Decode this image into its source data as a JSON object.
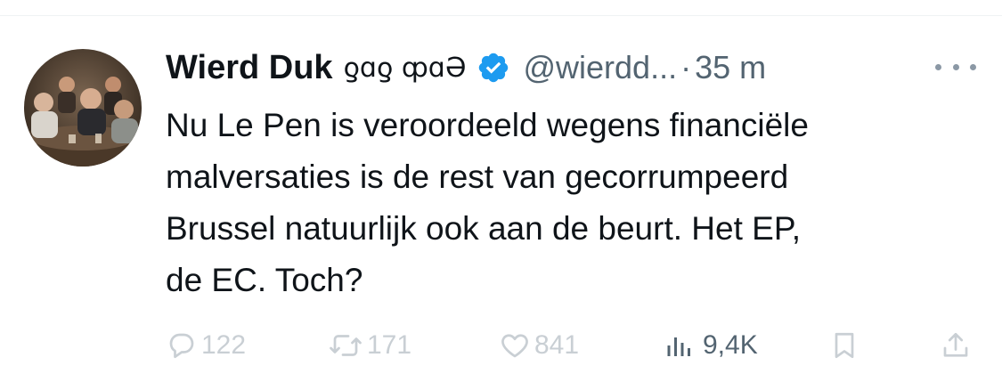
{
  "tweet": {
    "author": {
      "display_name": "Wierd Duk",
      "name_glyphs": "ƍɑƍ ȹɑƏ",
      "handle": "@wierdd...",
      "verified": true
    },
    "separator": "·",
    "time": "35 m",
    "text_lines": [
      "Nu Le Pen is veroordeeld wegens financiële",
      "malversaties is de rest van gecorrumpeerd",
      "Brussel natuurlijk ook aan de beurt. Het EP,",
      "de EC. Toch?"
    ]
  },
  "actions": {
    "replies": "122",
    "reposts": "171",
    "likes": "841",
    "views": "9,4K"
  },
  "icons": {
    "reply": "reply-icon",
    "repost": "repost-icon",
    "like": "heart-icon",
    "views": "views-bar-chart-icon",
    "bookmark": "bookmark-icon",
    "share": "share-icon",
    "more": "more-dots-icon",
    "verified": "verified-badge-icon"
  },
  "colors": {
    "text_primary": "#0f1419",
    "text_secondary": "#536471",
    "verified_blue": "#1d9bf0",
    "actions_faded": "#c9cfd4"
  }
}
